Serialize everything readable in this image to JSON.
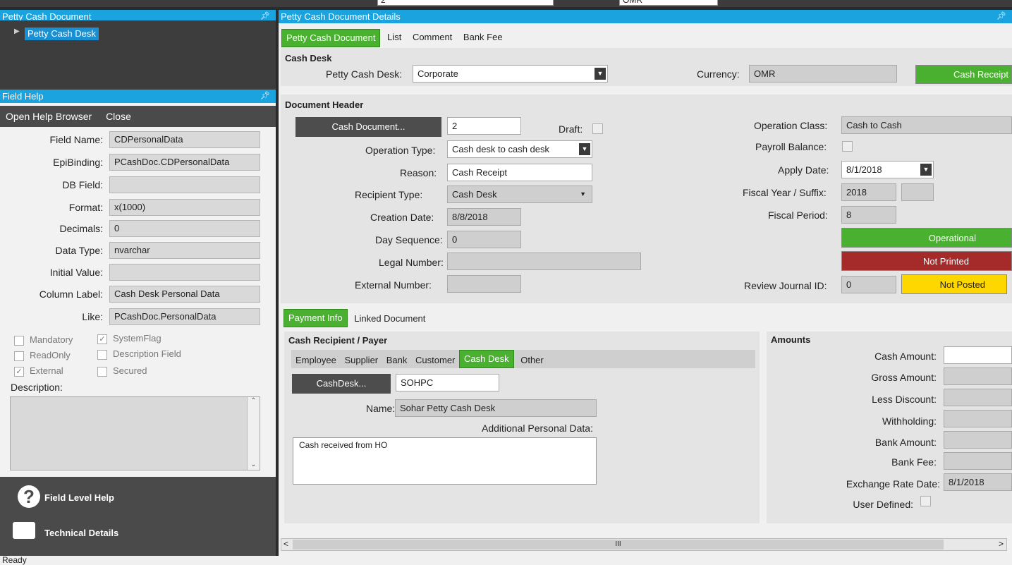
{
  "toolbar": {
    "field1": "2",
    "field2": "OMR"
  },
  "tree_panel": {
    "title": "Petty Cash Document",
    "item": "Petty Cash Desk"
  },
  "field_help": {
    "title": "Field Help",
    "menu": [
      "Open Help Browser",
      "Close"
    ],
    "rows": [
      {
        "label": "Field Name:",
        "value": "CDPersonalData"
      },
      {
        "label": "EpiBinding:",
        "value": "PCashDoc.CDPersonalData"
      },
      {
        "label": "DB Field:",
        "value": ""
      },
      {
        "label": "Format:",
        "value": "x(1000)"
      },
      {
        "label": "Decimals:",
        "value": "0"
      },
      {
        "label": "Data Type:",
        "value": "nvarchar"
      },
      {
        "label": "Initial Value:",
        "value": ""
      },
      {
        "label": "Column Label:",
        "value": "Cash Desk Personal Data"
      },
      {
        "label": "Like:",
        "value": "PCashDoc.PersonalData"
      }
    ],
    "checks": [
      {
        "label": "Mandatory",
        "checked": false
      },
      {
        "label": "SystemFlag",
        "checked": true
      },
      {
        "label": "ReadOnly",
        "checked": false
      },
      {
        "label": "Description Field",
        "checked": false
      },
      {
        "label": "External",
        "checked": true
      },
      {
        "label": "Secured",
        "checked": false
      }
    ],
    "description_label": "Description:",
    "bottom": [
      "Field Level Help",
      "Technical Details"
    ]
  },
  "main": {
    "title": "Petty Cash Document Details",
    "tabs": [
      "Petty Cash Document",
      "List",
      "Comment",
      "Bank Fee"
    ],
    "cash_desk": {
      "title": "Cash Desk",
      "petty_label": "Petty Cash Desk:",
      "petty_value": "Corporate",
      "currency_label": "Currency:",
      "currency_value": "OMR",
      "status": "Cash Receipt"
    },
    "header": {
      "title": "Document Header",
      "cash_doc_btn": "Cash Document...",
      "cash_doc_value": "2",
      "draft_label": "Draft:",
      "op_type_label": "Operation Type:",
      "op_type_value": "Cash desk to cash desk",
      "reason_label": "Reason:",
      "reason_value": "Cash Receipt",
      "recipient_label": "Recipient Type:",
      "recipient_value": "Cash Desk",
      "creation_label": "Creation Date:",
      "creation_value": "8/8/2018",
      "dayseq_label": "Day Sequence:",
      "dayseq_value": "0",
      "legal_label": "Legal Number:",
      "legal_value": "",
      "external_label": "External Number:",
      "external_value": "",
      "opclass_label": "Operation Class:",
      "opclass_value": "Cash to Cash",
      "payroll_label": "Payroll Balance:",
      "apply_label": "Apply Date:",
      "apply_value": "8/1/2018",
      "fiscal_label": "Fiscal Year / Suffix:",
      "fiscal_value": "2018",
      "period_label": "Fiscal Period:",
      "period_value": "8",
      "operational": "Operational",
      "not_printed": "Not Printed",
      "review_label": "Review Journal ID:",
      "review_value": "0",
      "not_posted": "Not Posted"
    },
    "payment_tabs": [
      "Payment Info",
      "Linked Document"
    ],
    "recipient": {
      "title": "Cash Recipient / Payer",
      "tabs": [
        "Employee",
        "Supplier",
        "Bank",
        "Customer",
        "Cash Desk",
        "Other"
      ],
      "cashdesk_btn": "CashDesk...",
      "cashdesk_value": "SOHPC",
      "name_label": "Name:",
      "name_value": "Sohar Petty Cash Desk",
      "additional_label": "Additional Personal Data:",
      "additional_value": "Cash received from HO"
    },
    "amounts": {
      "title": "Amounts",
      "rows": [
        "Cash Amount:",
        "Gross Amount:",
        "Less Discount:",
        "Withholding:",
        "Bank Amount:",
        "Bank Fee:"
      ],
      "exchange_label": "Exchange Rate Date:",
      "exchange_value": "8/1/2018",
      "user_defined_label": "User Defined:"
    },
    "scroll_mid": "III"
  },
  "status_bar": "Ready",
  "colors": {
    "accent": "#1aa3df",
    "green": "#4ab030",
    "red": "#a52a2a",
    "yellow": "#ffd700"
  }
}
